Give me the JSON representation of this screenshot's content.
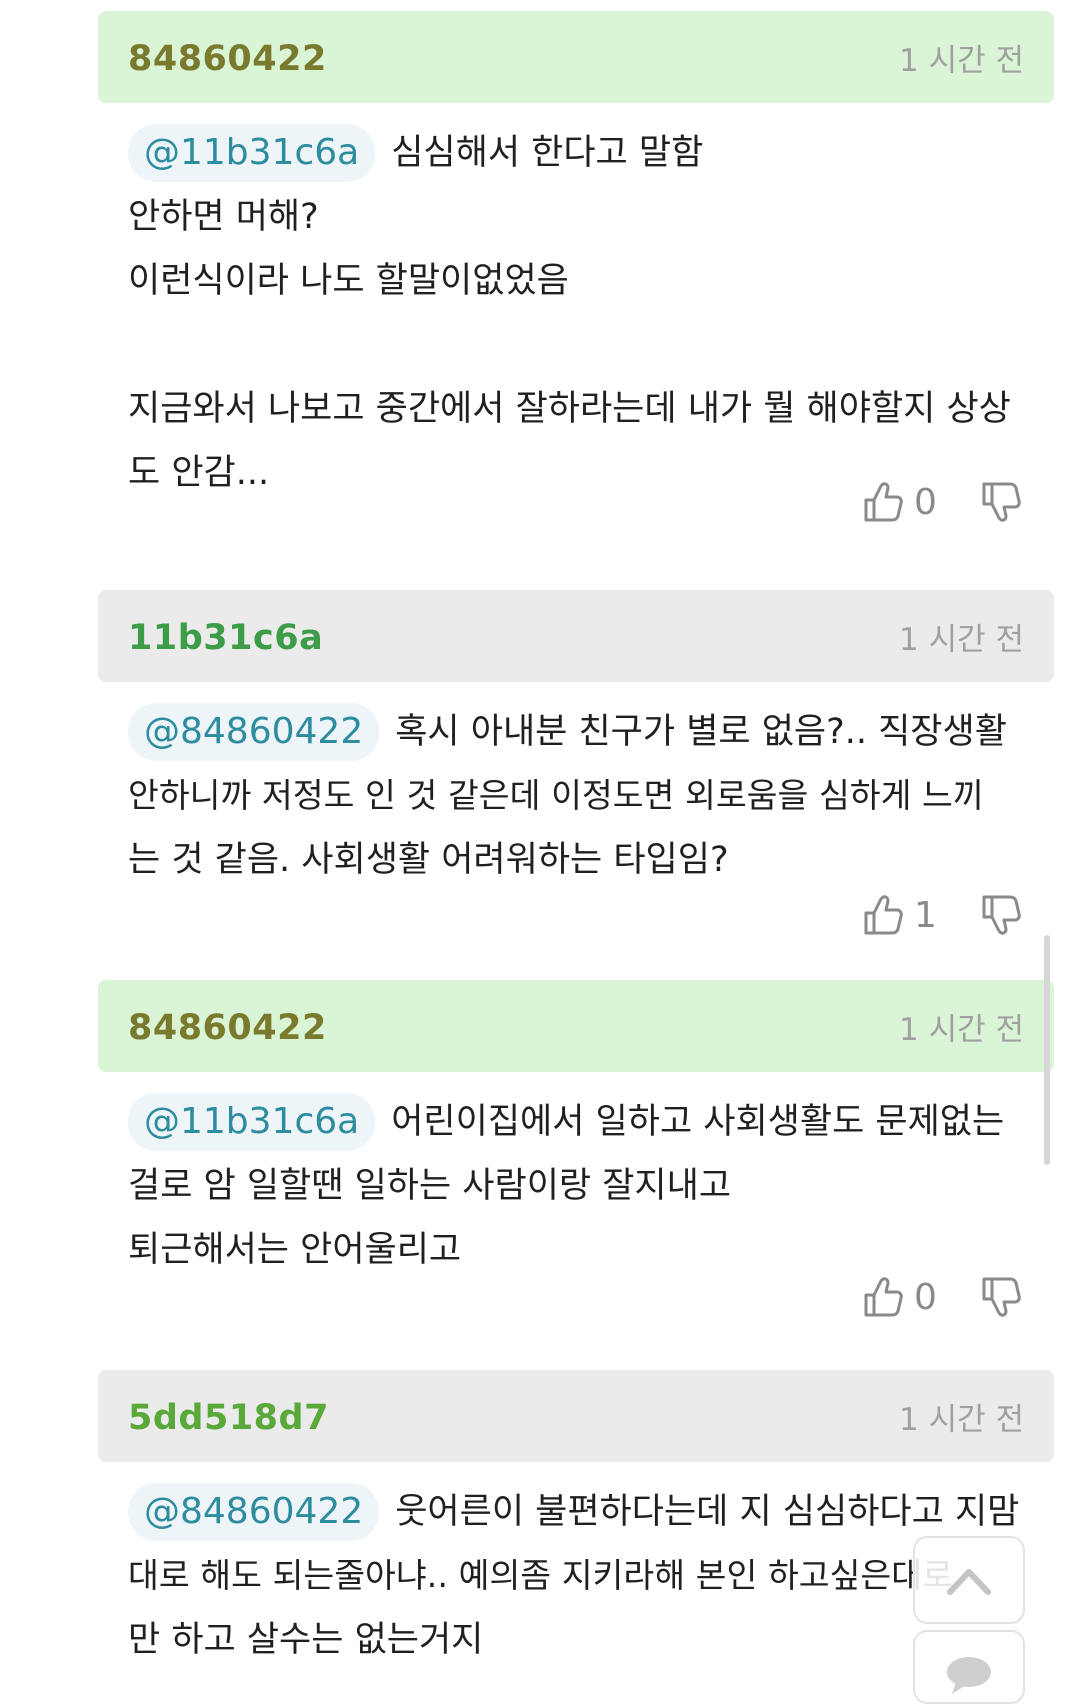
{
  "comments": [
    {
      "author": "84860422",
      "author_color": "#7a7a2e",
      "header_bg": "green",
      "time": "1 시간 전",
      "mention": "@11b31c6a",
      "lines": [
        "심심해서 한다고 말함",
        "안하면 머해?",
        "이런식이라 나도 할말이없었음",
        "",
        "지금와서 나보고 중간에서 잘하라는데 내가 뭘 해야할지 상상",
        "도 안감..."
      ],
      "likes": "0"
    },
    {
      "author": "11b31c6a",
      "author_color": "#3c9c48",
      "header_bg": "gray",
      "time": "1 시간 전",
      "mention": "@84860422",
      "lines": [
        "혹시 아내분 친구가 별로 없음?.. 직장생활",
        "안하니까 저정도 인 것 같은데 이정도면 외로움을 심하게 느끼",
        "는 것 같음. 사회생활 어려워하는 타입임?"
      ],
      "likes": "1"
    },
    {
      "author": "84860422",
      "author_color": "#7a7a2e",
      "header_bg": "green",
      "time": "1 시간 전",
      "mention": "@11b31c6a",
      "lines": [
        "어린이집에서 일하고 사회생활도 문제없는",
        "걸로 암 일할땐 일하는 사람이랑 잘지내고",
        "퇴근해서는 안어울리고"
      ],
      "likes": "0"
    },
    {
      "author": "5dd518d7",
      "author_color": "#5aa83a",
      "header_bg": "gray",
      "time": "1 시간 전",
      "mention": "@84860422",
      "lines": [
        "웃어른이 불편하다는데 지 심심하다고 지맘",
        "대로 해도 되는줄아냐.. 예의좀 지키라해 본인 하고싶은대로",
        "만 하고 살수는 없는거지"
      ],
      "likes": null
    }
  ],
  "icons": {
    "like": "thumbs-up-icon",
    "dislike": "thumbs-down-icon",
    "scroll_top": "chevron-up-icon",
    "comment": "chat-bubble-icon"
  }
}
